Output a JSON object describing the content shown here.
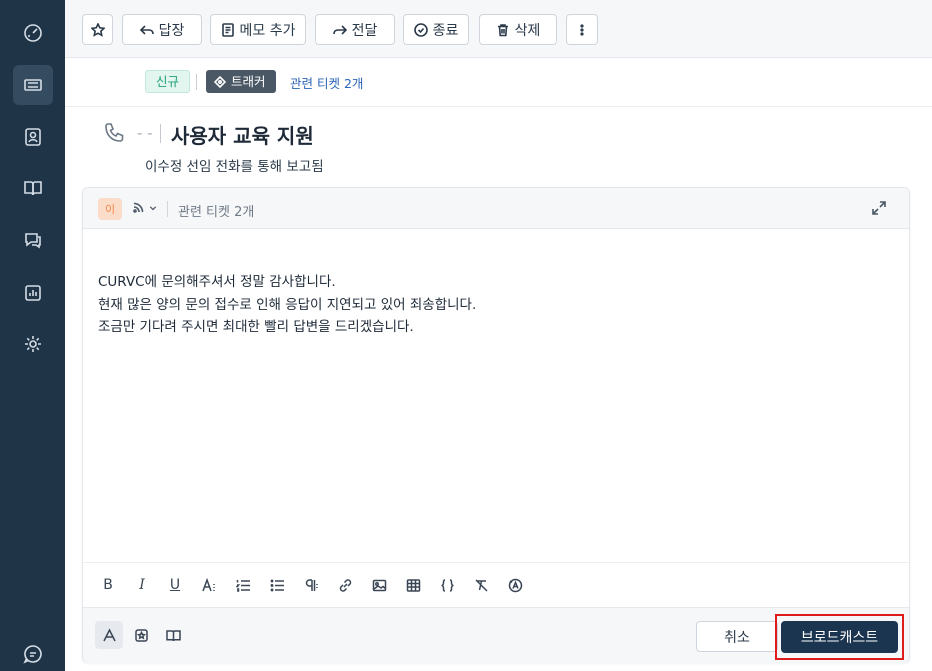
{
  "sidebar": {
    "items": [
      {
        "icon": "dashboard-icon"
      },
      {
        "icon": "ticket-icon",
        "active": true
      },
      {
        "icon": "contacts-icon"
      },
      {
        "icon": "knowledge-book-icon"
      },
      {
        "icon": "conversations-icon"
      },
      {
        "icon": "reports-icon"
      },
      {
        "icon": "settings-icon"
      },
      {
        "icon": "feedback-icon"
      }
    ]
  },
  "toolbar": {
    "star_icon": "star-icon",
    "reply_label": "답장",
    "note_label": "메모 추가",
    "forward_label": "전달",
    "close_label": "종료",
    "delete_label": "삭제",
    "more_icon": "more-vertical-icon"
  },
  "status": {
    "new_badge": "신규",
    "tracker_label": "트래커",
    "related_tickets": "관련 티켓 2개"
  },
  "ticket": {
    "dashes": "- -",
    "title": "사용자 교육 지원",
    "subtitle": "이수정 선임 전화를 통해 보고됨"
  },
  "editor": {
    "avatar_initial": "이",
    "related_tickets": "관련 티켓 2개",
    "body_lines": [
      "CURVC에 문의해주셔서 정말 감사합니다.",
      "현재 많은 양의 문의 접수로 인해 응답이 지연되고 있어 죄송합니다.",
      "조금만 기다려 주시면 최대한 빨리 답변을 드리겠습니다."
    ],
    "format_tools": [
      "B",
      "I",
      "U"
    ],
    "cancel_label": "취소",
    "broadcast_label": "브로드캐스트"
  },
  "colors": {
    "sidebar_bg": "#1f3447",
    "primary_button": "#1b3550",
    "highlight_border": "#e01b1b",
    "new_badge": "#22a277",
    "link": "#2a64b8"
  }
}
